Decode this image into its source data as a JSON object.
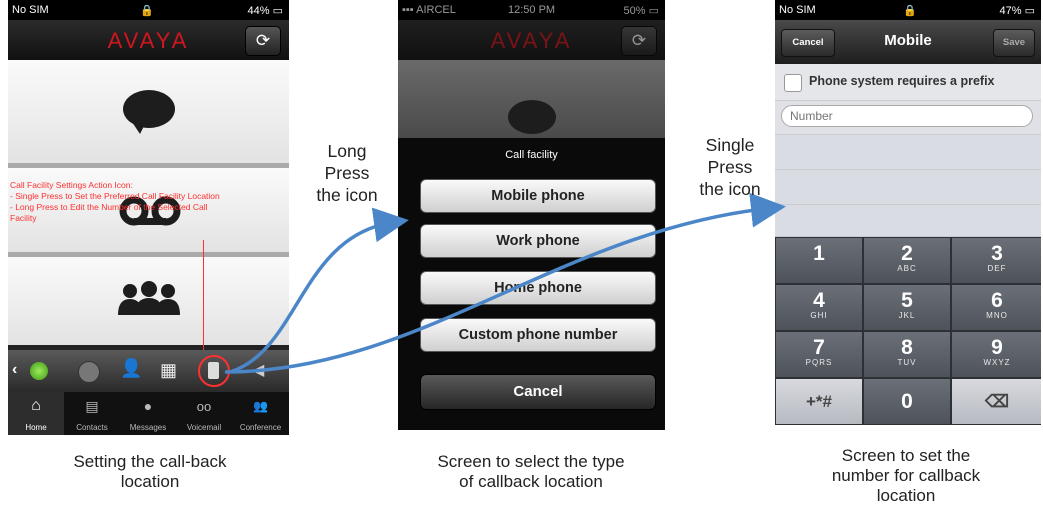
{
  "phone1": {
    "status": {
      "carrier": "No SIM",
      "battery": "44%"
    },
    "brand": "AVAYA",
    "annotation": [
      "Call Facility Settings Action Icon:",
      "- Single Press to Set the Preferred Call Facility Location",
      "- Long Press to Edit the Number of the Selected Call",
      "Facility"
    ],
    "tabs": [
      "Home",
      "Contacts",
      "Messages",
      "Voicemail",
      "Conference"
    ]
  },
  "phone2": {
    "status": {
      "carrier": "AIRCEL",
      "time": "12:50 PM",
      "battery": "50%"
    },
    "brand": "AVAYA",
    "menu_title": "Call facility",
    "options": [
      "Mobile phone",
      "Work phone",
      "Home phone",
      "Custom phone number"
    ],
    "cancel": "Cancel"
  },
  "phone3": {
    "status": {
      "carrier": "No SIM",
      "battery": "47%"
    },
    "nav": {
      "cancel": "Cancel",
      "title": "Mobile",
      "save": "Save"
    },
    "prefix_label": "Phone system requires a prefix",
    "number_placeholder": "Number",
    "keys": [
      {
        "d": "1",
        "l": ""
      },
      {
        "d": "2",
        "l": "ABC"
      },
      {
        "d": "3",
        "l": "DEF"
      },
      {
        "d": "4",
        "l": "GHI"
      },
      {
        "d": "5",
        "l": "JKL"
      },
      {
        "d": "6",
        "l": "MNO"
      },
      {
        "d": "7",
        "l": "PQRS"
      },
      {
        "d": "8",
        "l": "TUV"
      },
      {
        "d": "9",
        "l": "WXYZ"
      },
      {
        "d": "+*#",
        "l": ""
      },
      {
        "d": "0",
        "l": ""
      },
      {
        "d": "⌫",
        "l": ""
      }
    ]
  },
  "labels": {
    "long_press": [
      "Long",
      "Press",
      "the icon"
    ],
    "single_press": [
      "Single",
      "Press",
      "the icon"
    ]
  },
  "captions": {
    "c1": [
      "Setting the call-back",
      "location"
    ],
    "c2": [
      "Screen to select the type",
      "of callback location"
    ],
    "c3": [
      "Screen to set the",
      "number for callback",
      "location"
    ]
  },
  "colors": {
    "annotation": "#ff3030",
    "arrow": "#4a86c8",
    "brand": "#d0161e"
  }
}
